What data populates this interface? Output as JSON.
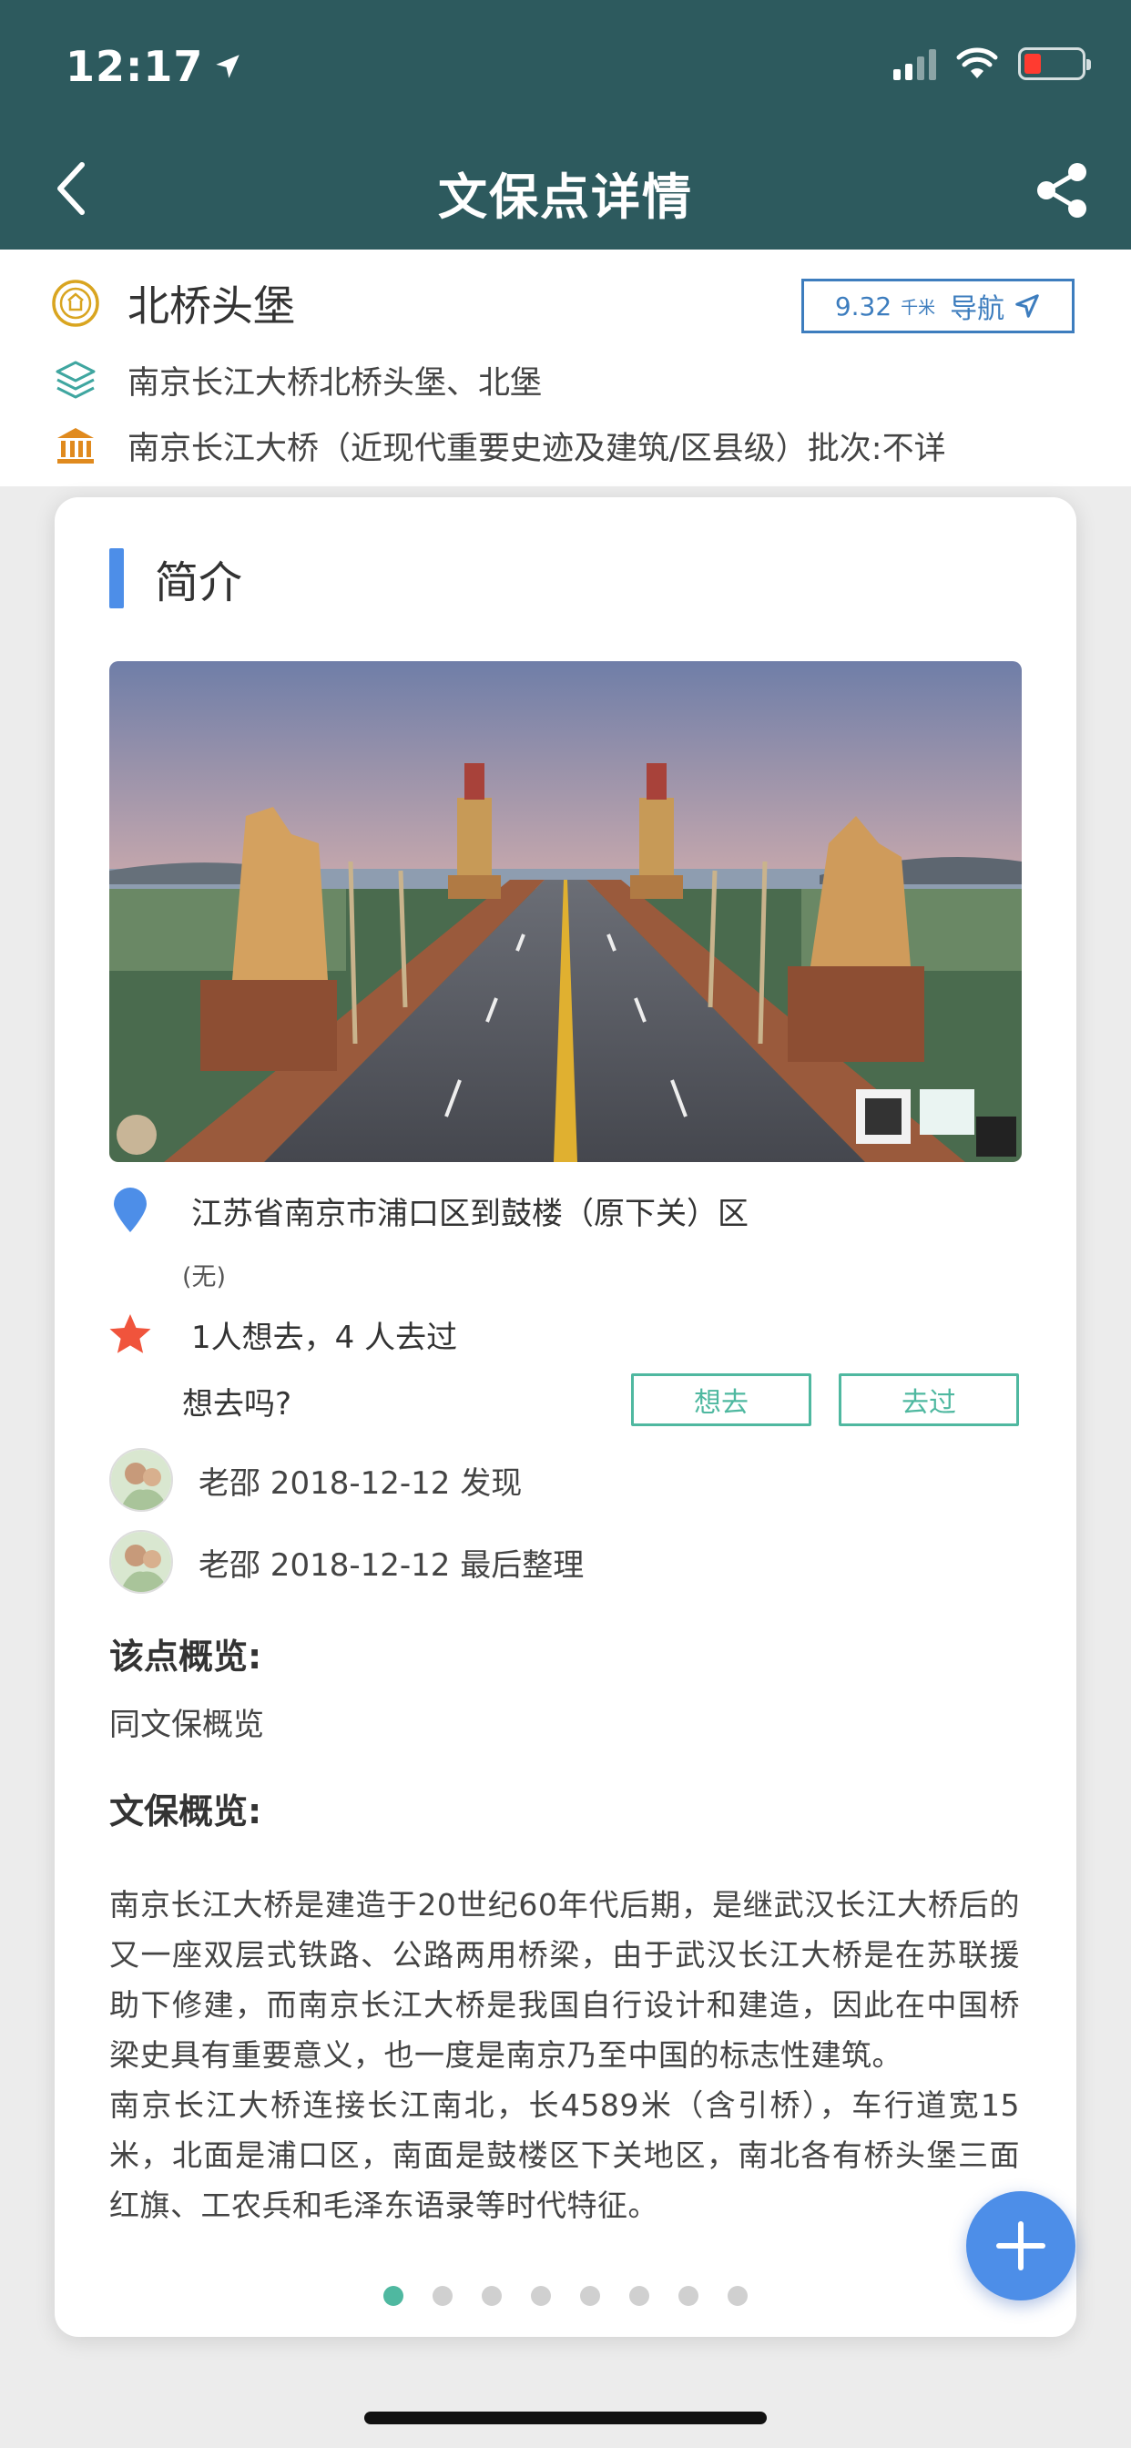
{
  "status_bar": {
    "time": "12:17"
  },
  "header": {
    "title": "文保点详情"
  },
  "site": {
    "name": "北桥头堡",
    "alias": "南京长江大桥北桥头堡、北堡",
    "heritage_level": "南京长江大桥（近现代重要史迹及建筑/区县级）批次:不详",
    "navigation": {
      "distance": "9.32",
      "unit": "千米",
      "label": "导航"
    }
  },
  "intro": {
    "section_title": "简介",
    "address": "江苏省南京市浦口区到鼓楼（原下关）区",
    "address_note": "(无)",
    "stats_text": "1人想去，4 人去过",
    "ask_text": "想去吗?",
    "want_button": "想去",
    "visited_button": "去过",
    "discovered": "老邵 2018-12-12 发现",
    "last_edited": "老邵 2018-12-12 最后整理",
    "overview_title": "该点概览:",
    "overview_text": "同文保概览",
    "heritage_overview_title": "文保概览:",
    "description_p1": "南京长江大桥是建造于20世纪60年代后期，是继武汉长江大桥后的又一座双层式铁路、公路两用桥梁，由于武汉长江大桥是在苏联援助下修建，而南京长江大桥是我国自行设计和建造，因此在中国桥梁史具有重要意义，也一度是南京乃至中国的标志性建筑。",
    "description_p2": "南京长江大桥连接长江南北，长4589米（含引桥），车行道宽15米，北面是浦口区，南面是鼓楼区下关地区，南北各有桥头堡三面红旗、工农兵和毛泽东语录等时代特征。"
  },
  "pagination": {
    "total": 8,
    "active_index": 0
  },
  "colors": {
    "header_bg": "#2d5a5e",
    "accent_blue": "#4d8ee8",
    "accent_green": "#4fb8a0",
    "nav_blue": "#3d7dbe",
    "star_red": "#f0543c",
    "gold_icon": "#d9a520"
  },
  "icons": {
    "status": [
      "location-arrow-icon",
      "signal-icon",
      "wifi-icon",
      "battery-icon"
    ],
    "header": [
      "back-chevron-icon",
      "share-icon"
    ],
    "info": [
      "seal-icon",
      "layers-icon",
      "museum-icon",
      "navigate-arrow-icon"
    ],
    "card": [
      "map-pin-icon",
      "star-icon",
      "plus-icon"
    ]
  }
}
